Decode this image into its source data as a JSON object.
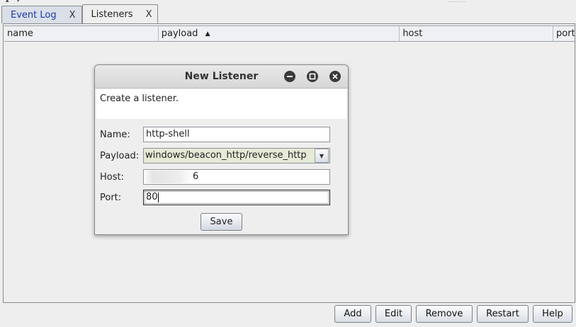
{
  "top_arrows": "▴ ▾",
  "tabs": [
    {
      "label": "Event Log",
      "close": "X"
    },
    {
      "label": "Listeners",
      "close": "X"
    }
  ],
  "table": {
    "columns": [
      "name",
      "payload",
      "host",
      "port"
    ],
    "sorted_column": "payload",
    "sort_direction": "ascending"
  },
  "buttons": {
    "add": "Add",
    "edit": "Edit",
    "remove": "Remove",
    "restart": "Restart",
    "help": "Help"
  },
  "dialog": {
    "title": "New Listener",
    "description": "Create a listener.",
    "name_label": "Name:",
    "name_value": "http-shell",
    "payload_label": "Payload:",
    "payload_value": "windows/beacon_http/reverse_http",
    "host_label": "Host:",
    "host_value_visible": "6",
    "port_label": "Port:",
    "port_value": "80",
    "save_label": "Save"
  }
}
